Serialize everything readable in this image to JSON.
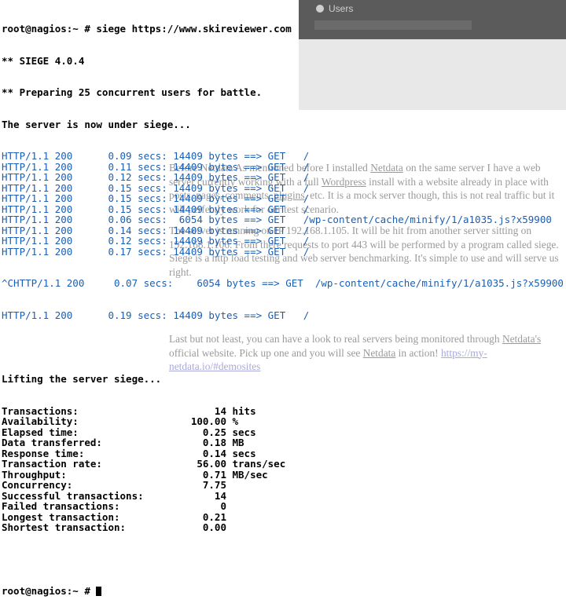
{
  "background": {
    "user_label": "Users",
    "article": {
      "p1_a": "Before Netdata As mentioned before I installed ",
      "p1_netdata": "Netdata",
      "p1_b": " on the same server I have a web server currently working with a full ",
      "p1_wordpress": "Wordpress",
      "p1_c": " install with a website already in place with posts, pages, comments, ",
      "p1_plugins": "plugins",
      "p1_d": ", etc. It is a mock server though, this is not real traffic but it will perfectly work for our test scenario.",
      "p2": "The server is running on IP 192.168.1.105. It will be hit from another server sitting on 192.168.1.106. From there requests to port 443 will be performed by a program called siege. Siege is a http load testing and web server benchmarking. It's simple to use and will serve us right.",
      "p3_a": "Last but not least, you can have a look to real servers being monitored through ",
      "p3_netdata1": "Netdata's",
      "p3_b": " official website. Pick up one and you will see ",
      "p3_netdata2": "Netdata",
      "p3_c": " in action! ",
      "p3_link": "https://my-netdata.io/#demosites"
    }
  },
  "terminal": {
    "command": "root@nagios:~ # siege https://www.skireviewer.com",
    "version": "** SIEGE 4.0.4",
    "preparing": "** Preparing 25 concurrent users for battle.",
    "under_siege": "The server is now under siege...",
    "requests": [
      {
        "proto": "HTTP/1.1 200",
        "time": "0.09 secs:",
        "bytes": "14409 bytes ==> GET",
        "path": "/"
      },
      {
        "proto": "HTTP/1.1 200",
        "time": "0.11 secs:",
        "bytes": "14409 bytes ==> GET",
        "path": "/"
      },
      {
        "proto": "HTTP/1.1 200",
        "time": "0.12 secs:",
        "bytes": "14409 bytes ==> GET",
        "path": "/"
      },
      {
        "proto": "HTTP/1.1 200",
        "time": "0.15 secs:",
        "bytes": "14409 bytes ==> GET",
        "path": "/"
      },
      {
        "proto": "HTTP/1.1 200",
        "time": "0.15 secs:",
        "bytes": "14409 bytes ==> GET",
        "path": "/"
      },
      {
        "proto": "HTTP/1.1 200",
        "time": "0.15 secs:",
        "bytes": "14409 bytes ==> GET",
        "path": "/"
      },
      {
        "proto": "HTTP/1.1 200",
        "time": "0.06 secs:",
        "bytes": " 6054 bytes ==> GET",
        "path": "/wp-content/cache/minify/1/a1035.js?x59900"
      },
      {
        "proto": "HTTP/1.1 200",
        "time": "0.14 secs:",
        "bytes": "14409 bytes ==> GET",
        "path": "/"
      },
      {
        "proto": "HTTP/1.1 200",
        "time": "0.12 secs:",
        "bytes": "14409 bytes ==> GET",
        "path": "/"
      },
      {
        "proto": "HTTP/1.1 200",
        "time": "0.17 secs:",
        "bytes": "14409 bytes ==> GET",
        "path": "/"
      }
    ],
    "interrupt_line": "^CHTTP/1.1 200     0.07 secs:    6054 bytes ==> GET  /wp-content/cache/minify/1/a1035.js?x59900",
    "last_request": {
      "proto": "HTTP/1.1 200",
      "time": "0.19 secs:",
      "bytes": "14409 bytes ==> GET",
      "path": "/"
    },
    "lifting": "Lifting the server siege...",
    "stats": [
      {
        "label": "Transactions:",
        "value": "14",
        "unit": "hits"
      },
      {
        "label": "Availability:",
        "value": "100.00",
        "unit": "%"
      },
      {
        "label": "Elapsed time:",
        "value": "0.25",
        "unit": "secs"
      },
      {
        "label": "Data transferred:",
        "value": "0.18",
        "unit": "MB"
      },
      {
        "label": "Response time:",
        "value": "0.14",
        "unit": "secs"
      },
      {
        "label": "Transaction rate:",
        "value": "56.00",
        "unit": "trans/sec"
      },
      {
        "label": "Throughput:",
        "value": "0.71",
        "unit": "MB/sec"
      },
      {
        "label": "Concurrency:",
        "value": "7.75",
        "unit": ""
      },
      {
        "label": "Successful transactions:",
        "value": "14",
        "unit": ""
      },
      {
        "label": "Failed transactions:",
        "value": "0",
        "unit": ""
      },
      {
        "label": "Longest transaction:",
        "value": "0.21",
        "unit": ""
      },
      {
        "label": "Shortest transaction:",
        "value": "0.00",
        "unit": ""
      }
    ],
    "prompt": "root@nagios:~ # "
  }
}
